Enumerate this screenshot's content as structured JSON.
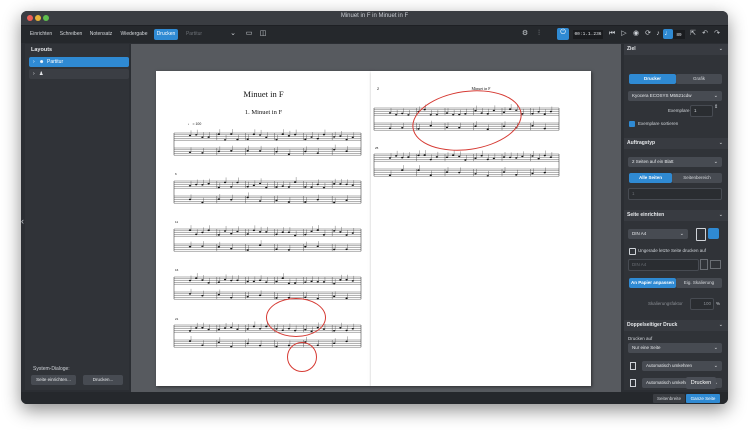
{
  "window": {
    "title": "Minuet in F in Minuet in F",
    "traffic_colors": [
      "#ec5f57",
      "#e7b43a",
      "#5fbe4f"
    ]
  },
  "toolbar": {
    "tabs": [
      {
        "label": "Einrichten",
        "state": "normal"
      },
      {
        "label": "Schreiben",
        "state": "normal"
      },
      {
        "label": "Notensatz",
        "state": "normal"
      },
      {
        "label": "Wiedergabe",
        "state": "normal"
      },
      {
        "label": "Drucken",
        "state": "active"
      },
      {
        "label": "Partitur",
        "state": "disabled"
      }
    ],
    "time_display": "00:1.1.236",
    "zoom_value": "89"
  },
  "left_panel": {
    "header": "Layouts",
    "items": [
      {
        "label": "Partitur",
        "icon": "people-icon"
      },
      {
        "label": "",
        "icon": "person-icon"
      }
    ],
    "system_dialogs_label": "System-Dialoge:",
    "page_setup_button": "Seite einrichten...",
    "print_button": "Drucken..."
  },
  "score": {
    "page1": {
      "title": "Minuet in F",
      "subtitle": "1. Minuet in F",
      "tempo": "♩ = 100",
      "measure_numbers": [
        "6",
        "11",
        "16",
        "21"
      ]
    },
    "page2": {
      "page_number": "2",
      "title": "Minuet in F",
      "measure_numbers": [
        "25"
      ]
    }
  },
  "right_panel": {
    "ziel": {
      "header": "Ziel",
      "dest_printer": "Drucker",
      "dest_graphic": "Grafik",
      "printer_name": "Kyocera ECOSYS M5521cdw",
      "copies_label": "Exemplare",
      "copies_value": "1",
      "collate_label": "Exemplare sortieren",
      "collate_checked": true
    },
    "auftragstyp": {
      "header": "Auftragstyp",
      "job_type": "2 Seiten auf ein Blatt",
      "all_pages": "Alle Seiten",
      "page_range": "Seitenbereich",
      "range_placeholder": "1"
    },
    "seite": {
      "header": "Seite einrichten",
      "paper_size": "DIN A4",
      "blank_last_label": "Ungerade letzte Seite drucken auf",
      "blank_last_checked": false,
      "blank_paper": "DIN A4",
      "fit_paper": "An Papier anpassen",
      "custom_scale": "Eig. Skalierung",
      "scale_label": "Skalierungsfaktor",
      "scale_value": "100",
      "scale_unit": "%"
    },
    "duplex": {
      "header": "Doppelseitiger Druck",
      "print_on_label": "Drucken auf",
      "print_on": "Nur eine Seite",
      "flip1": "Automatisch umkehren",
      "flip2": "Automatisch umkehren"
    },
    "print_button": "Drucken"
  },
  "bottom_bar": {
    "page_width": "Seitenbreite",
    "whole_page": "Ganze Seite"
  },
  "colors": {
    "accent": "#2f8ad3",
    "annotation": "#d63b34"
  }
}
